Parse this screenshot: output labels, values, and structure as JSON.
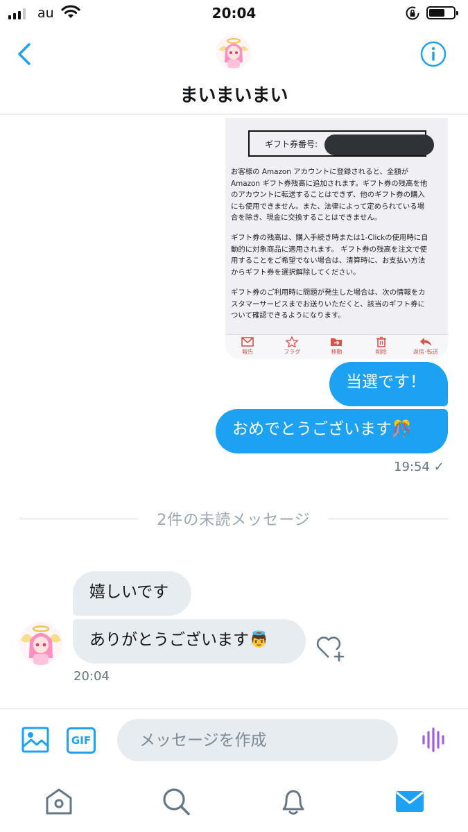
{
  "status_bar": {
    "carrier": "au",
    "time": "20:04",
    "battery_level": 0.55
  },
  "header": {
    "title": "まいまいまい",
    "icons": [
      "back-chevron-icon",
      "avatar",
      "info-icon"
    ]
  },
  "shared_image": {
    "code_label": "ギフト券番号:",
    "paragraphs": [
      "お客様の Amazon アカウントに登録されると、全額が\nAmazon ギフト券残高に追加されます。ギフト券の残高を他\nのアカウントに転送することはできず、他のギフト券の購入\nにも使用できません。また、法律によって定められている場\n合を除き、現金に交換することはできません。",
      "ギフト券の残高は、購入手続き時または1-Clickの使用時に自\n動的に対象商品に適用されます。 ギフト券の残高を注文で使\n用することをご希望でない場合は、清算時に、お支払い方法\nからギフト券を選択解除してください。",
      "ギフト券のご利用時に問題が発生した場合は、次の情報をカ\nスタマーサービスまでお送りいただくと、該当のギフト券に\nついて確認できるようになります。"
    ],
    "toolbar": [
      "報告",
      "フラグ",
      "移動",
      "削除",
      "返信･転送"
    ]
  },
  "messages": {
    "sent": [
      {
        "text": "当選です！"
      },
      {
        "text": "おめでとうございます🎊"
      }
    ],
    "sent_time": "19:54 ✓",
    "unread_label": "2件の未読メッセージ",
    "received": [
      {
        "text": "嬉しいです"
      },
      {
        "text": "ありがとうございます👼"
      }
    ],
    "received_time": "20:04"
  },
  "composer": {
    "placeholder": "メッセージを作成",
    "gif_label": "GIF"
  },
  "tabs": [
    "home-icon",
    "search-icon",
    "notifications-bell-icon",
    "messages-envelope-icon"
  ],
  "colors": {
    "accent": "#1da1f2",
    "received_bubble": "#e6ecf0",
    "voice_purple": "#a45ae6"
  }
}
